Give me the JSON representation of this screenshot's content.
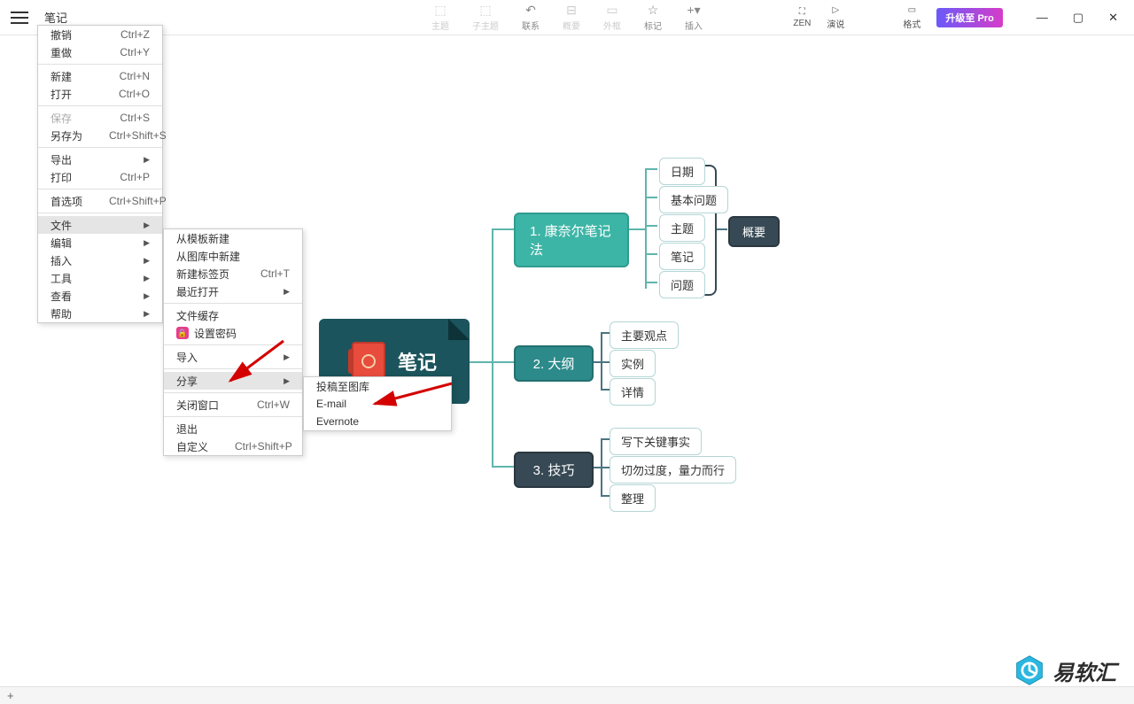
{
  "doc_title": "笔记",
  "toolbar": {
    "topic": "主题",
    "subtopic": "子主题",
    "relation": "联系",
    "summary": "概要",
    "boundary": "外框",
    "marker": "标记",
    "insert": "插入",
    "zen": "ZEN",
    "present": "演说",
    "format": "格式",
    "upgrade": "升级至 Pro"
  },
  "menu1": {
    "undo": "撤销",
    "undo_sc": "Ctrl+Z",
    "redo": "重做",
    "redo_sc": "Ctrl+Y",
    "new": "新建",
    "new_sc": "Ctrl+N",
    "open": "打开",
    "open_sc": "Ctrl+O",
    "save": "保存",
    "save_sc": "Ctrl+S",
    "saveas": "另存为",
    "saveas_sc": "Ctrl+Shift+S",
    "export": "导出",
    "print": "打印",
    "print_sc": "Ctrl+P",
    "pref": "首选项",
    "pref_sc": "Ctrl+Shift+P",
    "file": "文件",
    "edit": "编辑",
    "insert": "插入",
    "tools": "工具",
    "view": "查看",
    "help": "帮助"
  },
  "menu2": {
    "from_template": "从模板新建",
    "from_gallery": "从图库中新建",
    "new_tab": "新建标签页",
    "new_tab_sc": "Ctrl+T",
    "recent": "最近打开",
    "cache": "文件缓存",
    "set_pwd": "设置密码",
    "import": "导入",
    "share": "分享",
    "close_win": "关闭窗口",
    "close_win_sc": "Ctrl+W",
    "exit": "退出",
    "custom": "自定义",
    "custom_sc": "Ctrl+Shift+P"
  },
  "menu3": {
    "post_gallery": "投稿至图库",
    "email": "E-mail",
    "evernote": "Evernote"
  },
  "mindmap": {
    "root": "笔记",
    "b1": "1. 康奈尔笔记法",
    "b2": "2. 大纲",
    "b3": "3. 技巧",
    "l1": [
      "日期",
      "基本问题",
      "主题",
      "笔记",
      "问题"
    ],
    "summary": "概要",
    "l2": [
      "主要观点",
      "实例",
      "详情"
    ],
    "l3": [
      "写下关键事实",
      "切勿过度，量力而行",
      "整理"
    ]
  },
  "watermark": "易软汇"
}
